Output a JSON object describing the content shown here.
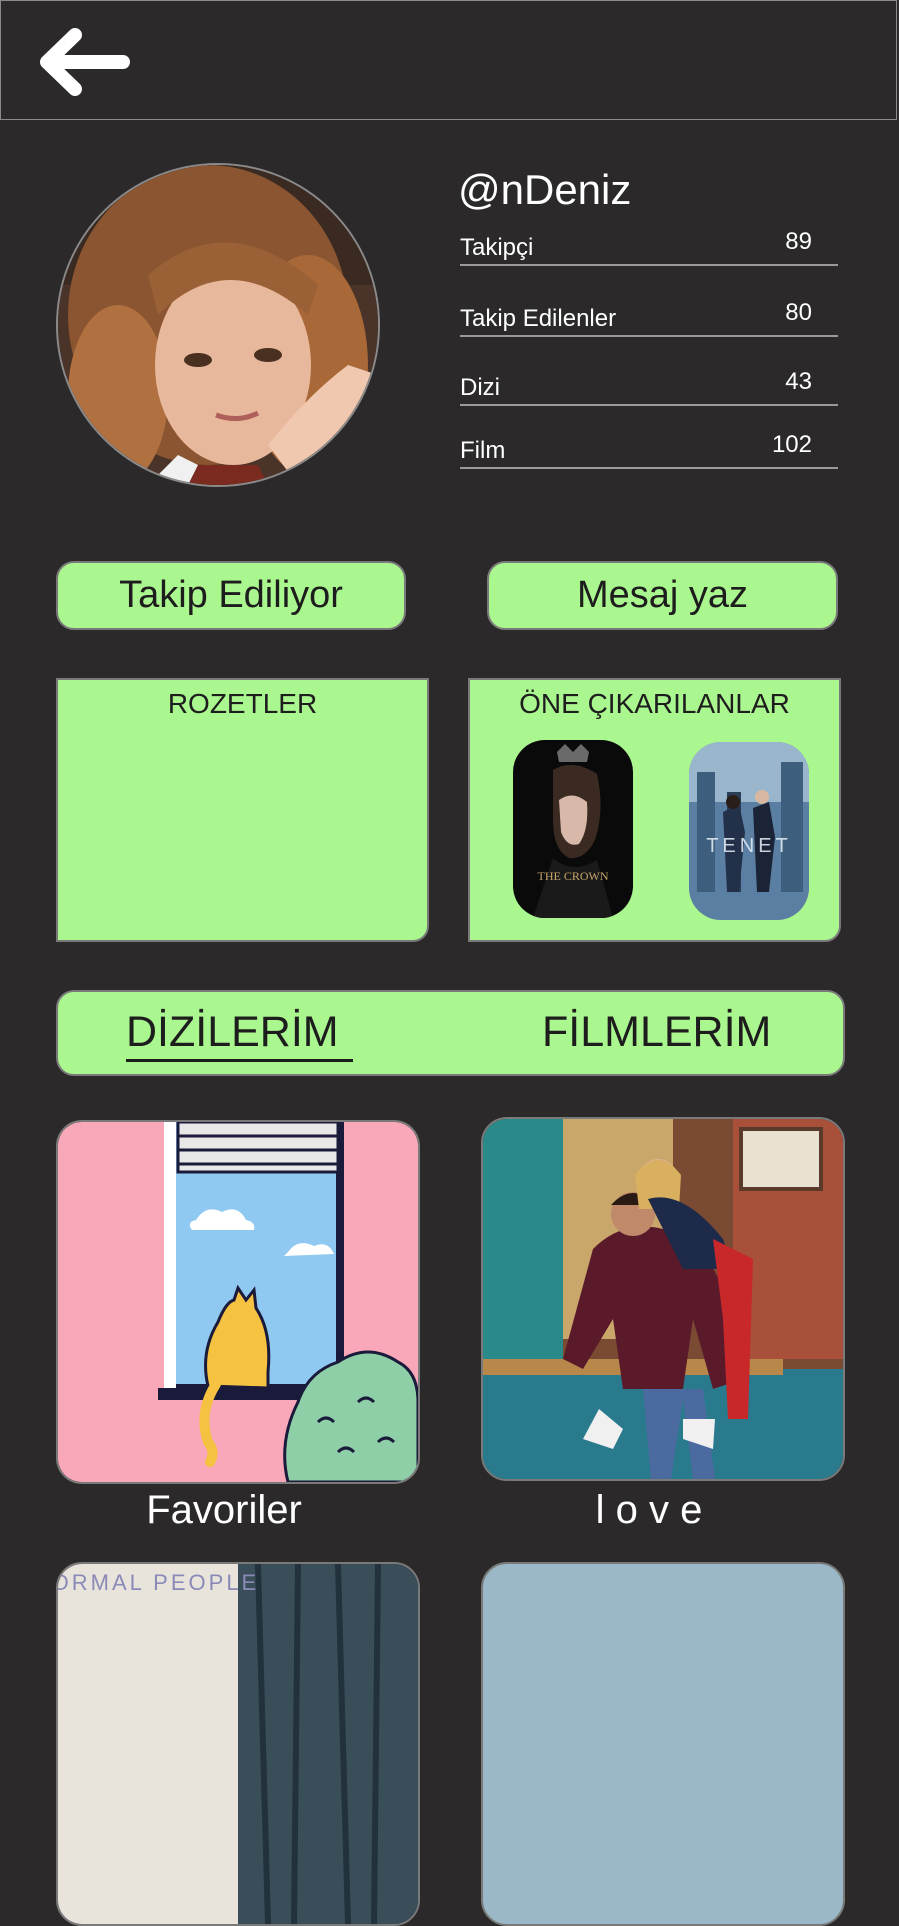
{
  "header": {
    "back_icon": "arrow-left-icon"
  },
  "profile": {
    "username": "@nDeniz",
    "stats": [
      {
        "label": "Takipçi",
        "value": "89"
      },
      {
        "label": "Takip Edilenler",
        "value": "80"
      },
      {
        "label": "Dizi",
        "value": "43"
      },
      {
        "label": "Film",
        "value": "102"
      }
    ]
  },
  "actions": {
    "follow_label": "Takip Ediliyor",
    "message_label": "Mesaj yaz"
  },
  "badges": {
    "title": "ROZETLER"
  },
  "highlights": {
    "title": "ÖNE ÇIKARILANLAR",
    "poster1_text": "THE CROWN",
    "poster2_text": "TENET"
  },
  "tabs": {
    "series": "DİZİLERİM",
    "films": "FİLMLERİM",
    "active": "series"
  },
  "lists": [
    {
      "label": "Favoriler"
    },
    {
      "label": "l o v e"
    }
  ],
  "partial_cards": {
    "card3_text": "NORMAL PEOPLE"
  },
  "colors": {
    "background": "#2b2929",
    "accent": "#aaf68f",
    "border": "#7a7a7a"
  }
}
